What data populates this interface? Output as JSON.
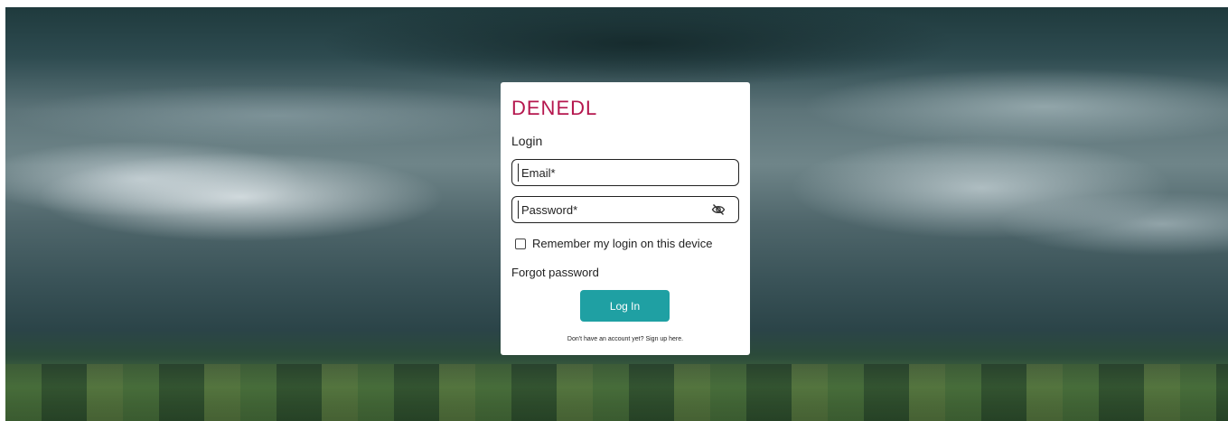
{
  "brand": {
    "logo_text": "DENEDL",
    "color": "#b5174e"
  },
  "login": {
    "heading": "Login",
    "email_placeholder": "Email*",
    "password_placeholder": "Password*",
    "password_toggle_icon": "eye-slash-icon",
    "remember_label": "Remember my login on this device",
    "remember_checked": false,
    "forgot_password": "Forgot password",
    "submit_label": "Log In",
    "submit_color": "#1fa0a3",
    "signup_text": "Don't have an account yet? Sign up here."
  }
}
